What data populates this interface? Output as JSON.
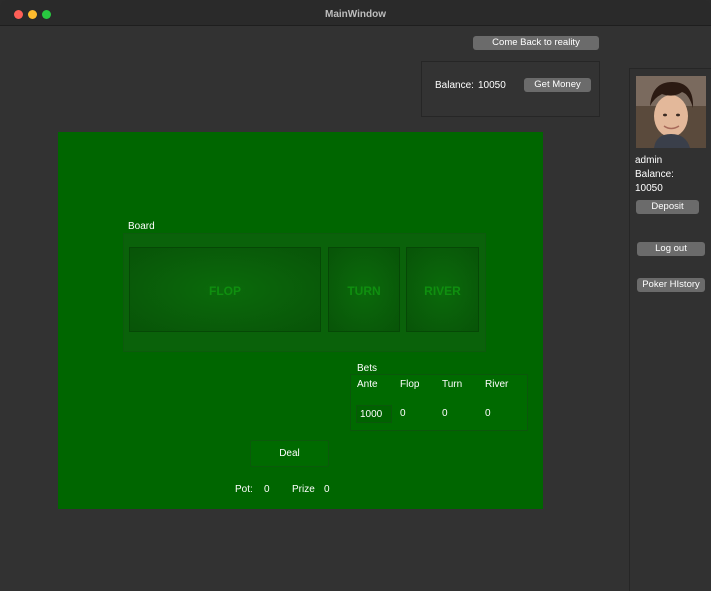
{
  "window": {
    "title": "MainWindow"
  },
  "header": {
    "reality_button": "Come Back to reality",
    "balance_label": "Balance:",
    "balance_value": "10050",
    "get_money_button": "Get Money"
  },
  "sidebar": {
    "username": "admin",
    "balance_label": "Balance:",
    "balance_value": "10050",
    "deposit_button": "Deposit",
    "logout_button": "Log out",
    "history_button": "Poker HIstory"
  },
  "board": {
    "title": "Board",
    "flop": "FLOP",
    "turn": "TURN",
    "river": "RIVER"
  },
  "bets": {
    "title": "Bets",
    "columns": [
      "Ante",
      "Flop",
      "Turn",
      "River"
    ],
    "ante_value": "1000",
    "flop_value": "0",
    "turn_value": "0",
    "river_value": "0"
  },
  "controls": {
    "deal_button": "Deal",
    "pot_label": "Pot:",
    "pot_value": "0",
    "prize_label": "Prize",
    "prize_value": "0"
  },
  "colors": {
    "table": "#006600",
    "window": "#323232",
    "button": "#6b6b6b"
  },
  "icons": [
    "close-icon",
    "minimize-icon",
    "maximize-icon"
  ]
}
